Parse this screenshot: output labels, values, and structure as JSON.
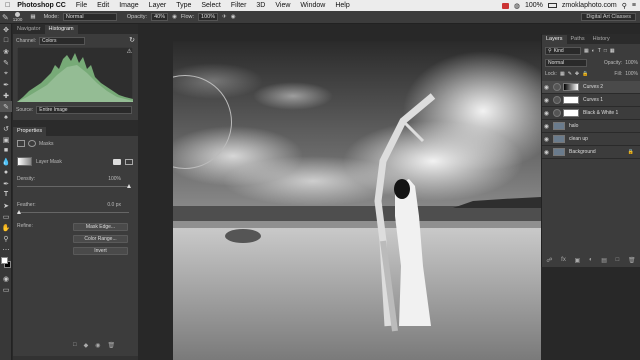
{
  "menubar": {
    "app": "Photoshop CC",
    "items": [
      "File",
      "Edit",
      "Image",
      "Layer",
      "Type",
      "Select",
      "Filter",
      "3D",
      "View",
      "Window",
      "Help"
    ],
    "zoom_text": "100%",
    "site": "zmoklaphoto.com"
  },
  "options": {
    "brush_size": "1100",
    "mode_label": "Mode:",
    "mode_value": "Normal",
    "opacity_label": "Opacity:",
    "opacity_value": "40%",
    "flow_label": "Flow:",
    "flow_value": "100%",
    "workspace": "Digital Art Classes"
  },
  "histogram": {
    "tabs": [
      "Navigator",
      "Histogram"
    ],
    "channel_label": "Channel:",
    "channel_value": "Colors",
    "source_label": "Source:",
    "source_value": "Entire Image"
  },
  "properties": {
    "tab": "Properties",
    "masks_label": "Masks",
    "layer_mask_label": "Layer Mask",
    "density_label": "Density:",
    "density_value": "100%",
    "density_fraction": 1.0,
    "feather_label": "Feather:",
    "feather_value": "0.0 px",
    "refine_label": "Refine:",
    "mask_edge": "Mask Edge...",
    "color_range": "Color Range...",
    "invert": "Invert"
  },
  "layers_panel": {
    "tabs": [
      "Layers",
      "Paths",
      "History"
    ],
    "kind_label": "Kind",
    "blend_mode": "Normal",
    "opacity_label": "Opacity:",
    "opacity_value": "100%",
    "lock_label": "Lock:",
    "fill_label": "Fill:",
    "fill_value": "100%",
    "layers": [
      {
        "name": "Curves 2",
        "active": true
      },
      {
        "name": "Curves 1",
        "active": false
      },
      {
        "name": "Black & White 1",
        "active": false
      },
      {
        "name": "halo",
        "active": false
      },
      {
        "name": "clean up",
        "active": false
      },
      {
        "name": "Background",
        "active": false
      }
    ]
  }
}
